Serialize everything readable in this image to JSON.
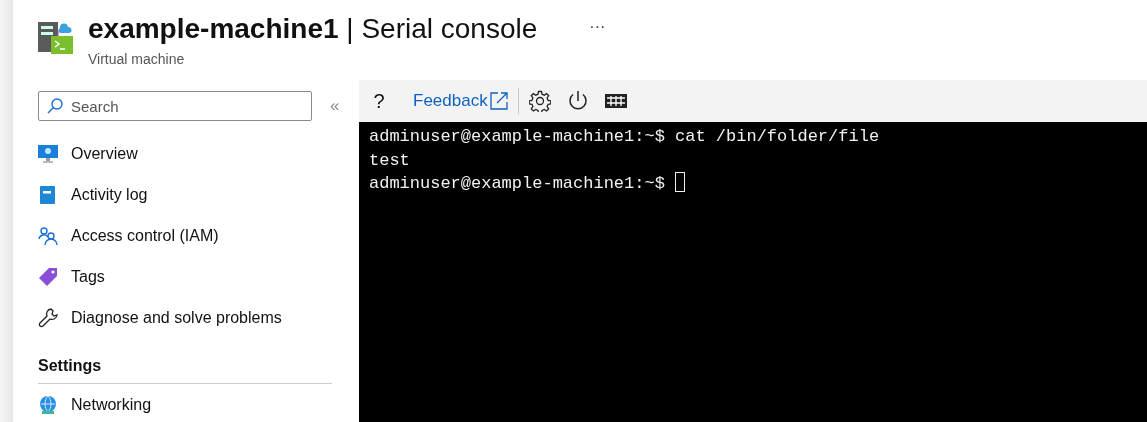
{
  "header": {
    "title": "**example-machine1** | Serial console",
    "subtitle": "Virtual machine",
    "more": "···"
  },
  "sidebar": {
    "search": {
      "placeholder": "Search"
    },
    "collapse": "«",
    "items": [
      {
        "label": "Overview"
      },
      {
        "label": "Activity log"
      },
      {
        "label": "Access control (IAM)"
      },
      {
        "label": "Tags"
      },
      {
        "label": "Diagnose and solve problems"
      }
    ],
    "sections": [
      {
        "heading": "Settings",
        "items": [
          {
            "label": "Networking"
          }
        ]
      }
    ]
  },
  "console": {
    "toolbar": {
      "help": "?",
      "feedback": "Feedback"
    },
    "lines": [
      "adminuser@example-machine1:~$ cat /bin/folder/file",
      "test",
      "adminuser@example-machine1:~$ "
    ]
  }
}
